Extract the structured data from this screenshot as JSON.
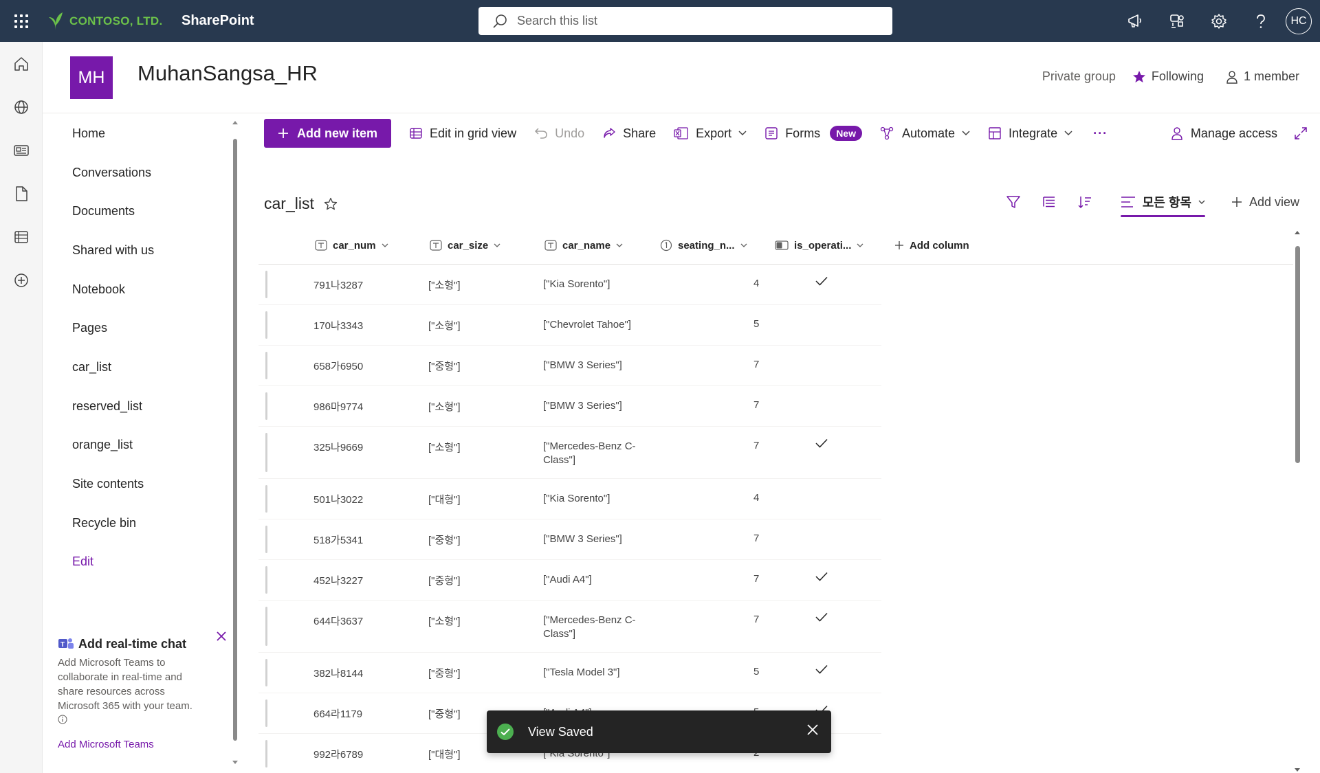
{
  "suite": {
    "brand": "CONTOSO, LTD.",
    "app": "SharePoint",
    "search_placeholder": "Search this list",
    "avatar": "HC",
    "icons": [
      "megaphone-icon",
      "teams-icon",
      "gear-icon",
      "help-icon"
    ]
  },
  "site": {
    "logo_initials": "MH",
    "title": "MuhanSangsa_HR",
    "privacy": "Private group",
    "following": "Following",
    "members": "1 member"
  },
  "nav": {
    "items": [
      {
        "label": "Home"
      },
      {
        "label": "Conversations"
      },
      {
        "label": "Documents"
      },
      {
        "label": "Shared with us"
      },
      {
        "label": "Notebook"
      },
      {
        "label": "Pages"
      },
      {
        "label": "car_list"
      },
      {
        "label": "reserved_list"
      },
      {
        "label": "orange_list"
      },
      {
        "label": "Site contents"
      },
      {
        "label": "Recycle bin"
      },
      {
        "label": "Edit"
      }
    ],
    "chat": {
      "title": "Add real-time chat",
      "description": "Add Microsoft Teams to collaborate in real-time and share resources across Microsoft 365 with your team.",
      "link": "Add Microsoft Teams"
    }
  },
  "commands": {
    "add_new_item": "Add new item",
    "edit_grid": "Edit in grid view",
    "undo": "Undo",
    "share": "Share",
    "export": "Export",
    "forms": "Forms",
    "forms_badge": "New",
    "automate": "Automate",
    "integrate": "Integrate",
    "more": "···",
    "manage_access": "Manage access"
  },
  "view": {
    "title": "car_list",
    "current_view": "모든 항목",
    "add_view": "Add view"
  },
  "columns": {
    "car_num": "car_num",
    "car_size": "car_size",
    "car_name": "car_name",
    "seating": "seating_n...",
    "is_operating": "is_operati...",
    "add_column": "Add column"
  },
  "rows": [
    {
      "car_num": "791나3287",
      "car_size": "[\"소형\"]",
      "car_name": "[\"Kia Sorento\"]",
      "seating": "4",
      "operating": true
    },
    {
      "car_num": "170나3343",
      "car_size": "[\"소형\"]",
      "car_name": "[\"Chevrolet Tahoe\"]",
      "seating": "5",
      "operating": false
    },
    {
      "car_num": "658가6950",
      "car_size": "[\"중형\"]",
      "car_name": "[\"BMW 3 Series\"]",
      "seating": "7",
      "operating": false
    },
    {
      "car_num": "986마9774",
      "car_size": "[\"소형\"]",
      "car_name": "[\"BMW 3 Series\"]",
      "seating": "7",
      "operating": false
    },
    {
      "car_num": "325나9669",
      "car_size": "[\"소형\"]",
      "car_name": "[\"Mercedes-Benz C-Class\"]",
      "seating": "7",
      "operating": true
    },
    {
      "car_num": "501나3022",
      "car_size": "[\"대형\"]",
      "car_name": "[\"Kia Sorento\"]",
      "seating": "4",
      "operating": false
    },
    {
      "car_num": "518가5341",
      "car_size": "[\"중형\"]",
      "car_name": "[\"BMW 3 Series\"]",
      "seating": "7",
      "operating": false
    },
    {
      "car_num": "452나3227",
      "car_size": "[\"중형\"]",
      "car_name": "[\"Audi A4\"]",
      "seating": "7",
      "operating": true
    },
    {
      "car_num": "644다3637",
      "car_size": "[\"소형\"]",
      "car_name": "[\"Mercedes-Benz C-Class\"]",
      "seating": "7",
      "operating": true
    },
    {
      "car_num": "382나8144",
      "car_size": "[\"중형\"]",
      "car_name": "[\"Tesla Model 3\"]",
      "seating": "5",
      "operating": true
    },
    {
      "car_num": "664라1179",
      "car_size": "[\"중형\"]",
      "car_name": "[\"Audi A4\"]",
      "seating": "5",
      "operating": true
    },
    {
      "car_num": "992라6789",
      "car_size": "[\"대형\"]",
      "car_name": "[\"Kia Sorento\"]",
      "seating": "2",
      "operating": false
    }
  ],
  "toast": {
    "message": "View Saved"
  },
  "colors": {
    "suite_bar": "#28394f",
    "accent": "#7719aa",
    "brand_green": "#6cc24a",
    "toast_success": "#4caf50"
  }
}
